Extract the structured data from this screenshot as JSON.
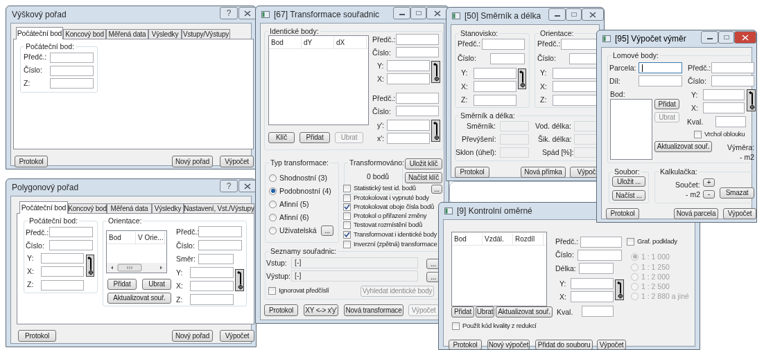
{
  "windows": [
    {
      "kind": "dialog",
      "title": "Výškový pořad",
      "help_glyph": "?",
      "active": false,
      "controls": [
        {
          "kind": "tab_page"
        },
        {
          "kind": "tab",
          "text": "Počáteční bod",
          "selected": true
        },
        {
          "kind": "tab",
          "text": "Koncový bod",
          "selected": false
        },
        {
          "kind": "tab",
          "text": "Měřená data",
          "selected": false
        },
        {
          "kind": "tab",
          "text": "Výsledky",
          "selected": false
        },
        {
          "kind": "tab",
          "text": "Vstupy/Výstupy",
          "selected": false
        },
        {
          "kind": "group",
          "text": "Počáteční bod:"
        },
        {
          "kind": "label",
          "text": "Předč.:"
        },
        {
          "kind": "field",
          "disabled": false
        },
        {
          "kind": "label",
          "text": "Číslo:"
        },
        {
          "kind": "field",
          "disabled": false
        },
        {
          "kind": "label",
          "text": "Z:"
        },
        {
          "kind": "field",
          "disabled": false
        },
        {
          "kind": "button",
          "text": "Protokol",
          "disabled": false
        },
        {
          "kind": "button",
          "text": "Nový pořad",
          "disabled": false
        },
        {
          "kind": "button",
          "text": "Výpočet",
          "disabled": false
        }
      ]
    },
    {
      "kind": "dialog",
      "title": "Polygonový pořad",
      "help_glyph": "?",
      "active": false,
      "controls": [
        {
          "kind": "tab_page"
        },
        {
          "kind": "tab",
          "text": "Počáteční bod",
          "selected": true
        },
        {
          "kind": "tab",
          "text": "Koncový bod",
          "selected": false
        },
        {
          "kind": "tab",
          "text": "Měřená data",
          "selected": false
        },
        {
          "kind": "tab",
          "text": "Výsledky",
          "selected": false
        },
        {
          "kind": "tab",
          "text": "Nastavení, Vst./Výstupy",
          "selected": false
        },
        {
          "kind": "group",
          "text": "Počáteční bod:"
        },
        {
          "kind": "label",
          "text": "Předč.:"
        },
        {
          "kind": "field",
          "disabled": false
        },
        {
          "kind": "label",
          "text": "Číslo:"
        },
        {
          "kind": "field",
          "disabled": false
        },
        {
          "kind": "label",
          "text": "Y:"
        },
        {
          "kind": "field",
          "disabled": false
        },
        {
          "kind": "label",
          "text": "X:"
        },
        {
          "kind": "field",
          "disabled": false
        },
        {
          "kind": "label",
          "text": "Z:"
        },
        {
          "kind": "field",
          "disabled": false
        },
        {
          "kind": "pick"
        },
        {
          "kind": "group",
          "text": "Orientace:"
        },
        {
          "kind": "list",
          "columns": [
            "Bod",
            "V Orie..."
          ],
          "horizontal_scroll": true
        },
        {
          "kind": "button",
          "text": "Přidat",
          "disabled": false
        },
        {
          "kind": "button",
          "text": "Ubrat",
          "disabled": false
        },
        {
          "kind": "button",
          "text": "Aktualizovat souř.",
          "disabled": false
        },
        {
          "kind": "label",
          "text": "Předč.:"
        },
        {
          "kind": "field",
          "disabled": false
        },
        {
          "kind": "label",
          "text": "Číslo:"
        },
        {
          "kind": "field",
          "disabled": false
        },
        {
          "kind": "label",
          "text": "Směr:"
        },
        {
          "kind": "field",
          "disabled": false
        },
        {
          "kind": "label",
          "text": "Y:"
        },
        {
          "kind": "field",
          "disabled": false
        },
        {
          "kind": "label",
          "text": "X:"
        },
        {
          "kind": "field",
          "disabled": false
        },
        {
          "kind": "label",
          "text": "Z:"
        },
        {
          "kind": "field",
          "disabled": false
        },
        {
          "kind": "pick"
        },
        {
          "kind": "button",
          "text": "Protokol",
          "disabled": false
        },
        {
          "kind": "button",
          "text": "Nový pořad",
          "disabled": false
        },
        {
          "kind": "button",
          "text": "Výpočet",
          "disabled": false
        }
      ]
    },
    {
      "kind": "tool",
      "title": "[67] Transformace souřadnic",
      "active": false,
      "controls": [
        {
          "kind": "group",
          "text": "Identické body:"
        },
        {
          "kind": "list",
          "columns": [
            "Bod",
            "dY",
            "dX"
          ]
        },
        {
          "kind": "button",
          "text": "Klíč",
          "disabled": false
        },
        {
          "kind": "button",
          "text": "Přidat",
          "disabled": false
        },
        {
          "kind": "button",
          "text": "Ubrat",
          "disabled": true
        },
        {
          "kind": "label",
          "text": "Předč.:"
        },
        {
          "kind": "field",
          "disabled": false
        },
        {
          "kind": "label",
          "text": "Číslo:"
        },
        {
          "kind": "field",
          "disabled": false
        },
        {
          "kind": "label",
          "text": "Y:"
        },
        {
          "kind": "field",
          "disabled": false
        },
        {
          "kind": "label",
          "text": "X:"
        },
        {
          "kind": "field",
          "disabled": false
        },
        {
          "kind": "pick"
        },
        {
          "kind": "label",
          "text": "Předč.:"
        },
        {
          "kind": "field",
          "disabled": false
        },
        {
          "kind": "label",
          "text": "Číslo:"
        },
        {
          "kind": "field",
          "disabled": false
        },
        {
          "kind": "label",
          "text": "y':"
        },
        {
          "kind": "field",
          "disabled": false
        },
        {
          "kind": "label",
          "text": "x':"
        },
        {
          "kind": "field",
          "disabled": false
        },
        {
          "kind": "pick"
        },
        {
          "kind": "group",
          "text": "Typ transformace:"
        },
        {
          "kind": "radio",
          "text": "Shodnostní (3)",
          "selected": false,
          "disabled": false
        },
        {
          "kind": "radio",
          "text": "Podobnostní (4)",
          "selected": true,
          "disabled": false
        },
        {
          "kind": "radio",
          "text": "Afinní (5)",
          "selected": false,
          "disabled": false
        },
        {
          "kind": "radio",
          "text": "Afinní (6)",
          "selected": false,
          "disabled": false
        },
        {
          "kind": "radio",
          "text": "Uživatelská",
          "selected": false,
          "disabled": false
        },
        {
          "kind": "button",
          "text": "...",
          "disabled": false
        },
        {
          "kind": "group",
          "text": "Transformováno:"
        },
        {
          "kind": "value",
          "text": "0 bodů"
        },
        {
          "kind": "button",
          "text": "Uložit klíč",
          "disabled": false
        },
        {
          "kind": "button",
          "text": "Načíst klíč",
          "disabled": false
        },
        {
          "kind": "check",
          "text": "Statistický test id. bodů",
          "checked": false
        },
        {
          "kind": "button",
          "text": "...",
          "disabled": false
        },
        {
          "kind": "check",
          "text": "Protokolovat i vypnuté body",
          "checked": false
        },
        {
          "kind": "check",
          "text": "Protokolovat oboje čísla bodů",
          "checked": true
        },
        {
          "kind": "check",
          "text": "Protokol o přiřazení změny",
          "checked": false
        },
        {
          "kind": "check",
          "text": "Testovat rozmístění bodů",
          "checked": false
        },
        {
          "kind": "check",
          "text": "Transformovat i identické body",
          "checked": true
        },
        {
          "kind": "check",
          "text": "Inverzní (zpětná) transformace",
          "checked": false
        },
        {
          "kind": "group",
          "text": "Seznamy souřadnic:"
        },
        {
          "kind": "label",
          "text": "Vstup:"
        },
        {
          "kind": "field",
          "value": "[-]",
          "disabled": true
        },
        {
          "kind": "button",
          "text": "...",
          "disabled": false
        },
        {
          "kind": "label",
          "text": "Výstup:"
        },
        {
          "kind": "field",
          "value": "[-]",
          "disabled": true
        },
        {
          "kind": "button",
          "text": "...",
          "disabled": false
        },
        {
          "kind": "check",
          "text": "Ignorovat předčíslí",
          "checked": false
        },
        {
          "kind": "button",
          "text": "Vyhledat identické body",
          "disabled": true
        },
        {
          "kind": "button",
          "text": "Protokol",
          "disabled": false
        },
        {
          "kind": "button",
          "text": "XY <-> x'y'",
          "disabled": false
        },
        {
          "kind": "button",
          "text": "Nová transformace",
          "disabled": false
        },
        {
          "kind": "button",
          "text": "Výpočet",
          "disabled": true
        }
      ]
    },
    {
      "kind": "tool",
      "title": "[50] Směrník a délka",
      "active": false,
      "controls": [
        {
          "kind": "group",
          "text": "Stanovisko:"
        },
        {
          "kind": "label",
          "text": "Předč.:"
        },
        {
          "kind": "field",
          "disabled": false
        },
        {
          "kind": "label",
          "text": "Číslo:"
        },
        {
          "kind": "field",
          "disabled": false
        },
        {
          "kind": "label",
          "text": "Y:"
        },
        {
          "kind": "field",
          "disabled": false
        },
        {
          "kind": "label",
          "text": "X:"
        },
        {
          "kind": "field",
          "disabled": false
        },
        {
          "kind": "label",
          "text": "Z:"
        },
        {
          "kind": "field",
          "disabled": false
        },
        {
          "kind": "pick"
        },
        {
          "kind": "group",
          "text": "Orientace:"
        },
        {
          "kind": "label",
          "text": "Předč.:"
        },
        {
          "kind": "field",
          "disabled": false
        },
        {
          "kind": "label",
          "text": "Číslo:"
        },
        {
          "kind": "field",
          "disabled": false
        },
        {
          "kind": "label",
          "text": "Y:"
        },
        {
          "kind": "field",
          "disabled": false
        },
        {
          "kind": "label",
          "text": "X:"
        },
        {
          "kind": "field",
          "disabled": false
        },
        {
          "kind": "label",
          "text": "Z:"
        },
        {
          "kind": "field",
          "disabled": false
        },
        {
          "kind": "group",
          "text": "Směrník a délka:"
        },
        {
          "kind": "label",
          "text": "Směrník:"
        },
        {
          "kind": "field",
          "disabled": true
        },
        {
          "kind": "label",
          "text": "Převýšení:"
        },
        {
          "kind": "field",
          "disabled": true
        },
        {
          "kind": "label",
          "text": "Sklon (úhel):"
        },
        {
          "kind": "field",
          "disabled": true
        },
        {
          "kind": "label",
          "text": "Vod. délka:"
        },
        {
          "kind": "field",
          "disabled": true
        },
        {
          "kind": "label",
          "text": "Šik. délka:"
        },
        {
          "kind": "field",
          "disabled": true
        },
        {
          "kind": "label",
          "text": "Spád [%]:"
        },
        {
          "kind": "field",
          "disabled": true
        },
        {
          "kind": "button",
          "text": "Protokol",
          "disabled": false
        },
        {
          "kind": "button",
          "text": "Nová přímka",
          "disabled": false
        },
        {
          "kind": "button",
          "text": "Výpoč",
          "disabled": false
        }
      ]
    },
    {
      "kind": "tool",
      "title": "[9] Kontrolní oměrné",
      "active": false,
      "controls": [
        {
          "kind": "list",
          "columns": [
            "Bod",
            "Vzdál.",
            "Rozdíl"
          ]
        },
        {
          "kind": "label",
          "text": "Předč.:"
        },
        {
          "kind": "field",
          "disabled": false
        },
        {
          "kind": "label",
          "text": "Číslo:"
        },
        {
          "kind": "field",
          "disabled": false
        },
        {
          "kind": "label",
          "text": "Délka:"
        },
        {
          "kind": "field",
          "disabled": false
        },
        {
          "kind": "label",
          "text": "Y:"
        },
        {
          "kind": "field",
          "disabled": false
        },
        {
          "kind": "label",
          "text": "X:"
        },
        {
          "kind": "field",
          "disabled": false
        },
        {
          "kind": "pick"
        },
        {
          "kind": "button",
          "text": "Přidat",
          "disabled": false
        },
        {
          "kind": "button",
          "text": "Ubrat",
          "disabled": false
        },
        {
          "kind": "button",
          "text": "Aktualizovat souř.",
          "disabled": false
        },
        {
          "kind": "label",
          "text": "Kval."
        },
        {
          "kind": "field",
          "disabled": false
        },
        {
          "kind": "check",
          "text": "Použít kód kvality z redukcí",
          "checked": false
        },
        {
          "kind": "check",
          "text": "Graf. podklady",
          "checked": false
        },
        {
          "kind": "radio",
          "text": "1 : 1 000",
          "selected": true,
          "disabled": true
        },
        {
          "kind": "radio",
          "text": "1 : 1 250",
          "selected": false,
          "disabled": true
        },
        {
          "kind": "radio",
          "text": "1 : 2 000",
          "selected": false,
          "disabled": true
        },
        {
          "kind": "radio",
          "text": "1 : 2 500",
          "selected": false,
          "disabled": true
        },
        {
          "kind": "radio",
          "text": "1 : 2 880 a jiné",
          "selected": false,
          "disabled": true
        },
        {
          "kind": "button",
          "text": "Protokol",
          "disabled": false
        },
        {
          "kind": "button",
          "text": "Nový výpočet",
          "disabled": false
        },
        {
          "kind": "button",
          "text": "Přidat do souboru",
          "disabled": false
        },
        {
          "kind": "button",
          "text": "Výpočet",
          "disabled": false
        }
      ]
    },
    {
      "kind": "tool",
      "title": "[95] Výpočet výměr",
      "active": true,
      "controls": [
        {
          "kind": "group",
          "text": "Lomové body:"
        },
        {
          "kind": "label",
          "text": "Parcela:"
        },
        {
          "kind": "field",
          "disabled": false,
          "focused": true
        },
        {
          "kind": "label",
          "text": "Díl:"
        },
        {
          "kind": "field",
          "disabled": false
        },
        {
          "kind": "label",
          "text": "Předč.:"
        },
        {
          "kind": "field",
          "disabled": false
        },
        {
          "kind": "label",
          "text": "Číslo:"
        },
        {
          "kind": "field",
          "disabled": false
        },
        {
          "kind": "label",
          "text": "Bod:"
        },
        {
          "kind": "listbox"
        },
        {
          "kind": "button",
          "text": "Přidat",
          "disabled": false
        },
        {
          "kind": "button",
          "text": "Ubrat",
          "disabled": true
        },
        {
          "kind": "label",
          "text": "Y:"
        },
        {
          "kind": "field",
          "disabled": false
        },
        {
          "kind": "label",
          "text": "X:"
        },
        {
          "kind": "field",
          "disabled": false
        },
        {
          "kind": "pick"
        },
        {
          "kind": "label",
          "text": "Kval."
        },
        {
          "kind": "field",
          "disabled": false
        },
        {
          "kind": "check",
          "text": "Vrchol oblouku",
          "checked": false
        },
        {
          "kind": "button",
          "text": "Aktualizovat souř.",
          "disabled": false
        },
        {
          "kind": "label",
          "text": "Výměra:"
        },
        {
          "kind": "value",
          "text": "- m2"
        },
        {
          "kind": "group",
          "text": "Soubor:"
        },
        {
          "kind": "button",
          "text": "Uložit ...",
          "disabled": false
        },
        {
          "kind": "button",
          "text": "Načíst ...",
          "disabled": false
        },
        {
          "kind": "group",
          "text": "Kalkulačka:"
        },
        {
          "kind": "label",
          "text": "Součet:"
        },
        {
          "kind": "button",
          "text": "+",
          "disabled": false
        },
        {
          "kind": "value",
          "text": "- m2"
        },
        {
          "kind": "button",
          "text": "-",
          "disabled": false
        },
        {
          "kind": "button",
          "text": "Smazat",
          "disabled": false
        },
        {
          "kind": "button",
          "text": "Protokol",
          "disabled": false
        },
        {
          "kind": "button",
          "text": "Nová parcela",
          "disabled": false
        },
        {
          "kind": "button",
          "text": "Výpočet",
          "disabled": false
        }
      ]
    }
  ]
}
